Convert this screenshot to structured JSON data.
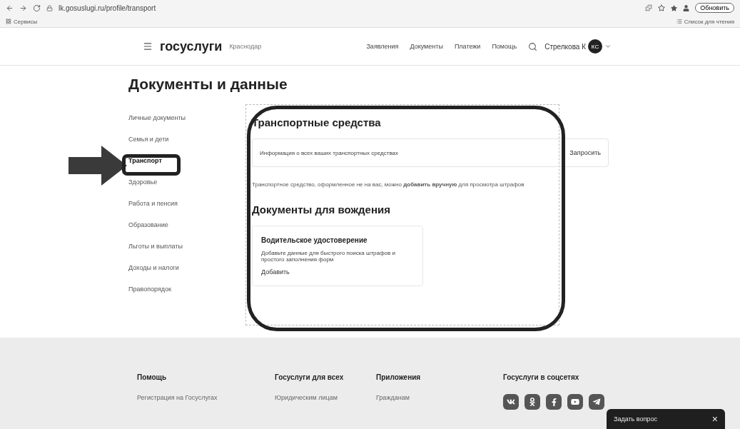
{
  "browser": {
    "url": "lk.gosuslugi.ru/profile/transport",
    "update_button": "Обновить",
    "bookmarks_left": "Сервисы",
    "bookmarks_right": "Список для чтения"
  },
  "header": {
    "logo": "госуслуги",
    "city": "Краснодар",
    "nav": [
      "Заявления",
      "Документы",
      "Платежи",
      "Помощь"
    ],
    "user": "Стрелкова К",
    "avatar": "КС"
  },
  "page_title": "Документы и данные",
  "sidebar": {
    "items": [
      {
        "label": "Личные документы",
        "selected": false
      },
      {
        "label": "Семья и дети",
        "selected": false
      },
      {
        "label": "Транспорт",
        "selected": true
      },
      {
        "label": "Здоровье",
        "selected": false
      },
      {
        "label": "Работа и пенсия",
        "selected": false
      },
      {
        "label": "Образование",
        "selected": false
      },
      {
        "label": "Льготы и выплаты",
        "selected": false
      },
      {
        "label": "Доходы и налоги",
        "selected": false
      },
      {
        "label": "Правопорядок",
        "selected": false
      }
    ]
  },
  "vehicles": {
    "title": "Транспортные средства",
    "request_row": {
      "text": "Информация о всех ваших транспортных средствах",
      "action": "Запросить"
    },
    "note": "Транспортное средство, оформленное не на вас, можно **добавить вручную** для просмотра штрафов"
  },
  "driving": {
    "title": "Документы для вождения",
    "card": {
      "title": "Водительское удостоверение",
      "text": "Добавьте данные для быстрого поиска штрафов и простого заполнения форм",
      "action": "Добавить"
    }
  },
  "footer": {
    "columns": [
      {
        "title": "Помощь",
        "link": "Регистрация на Госуслугах"
      },
      {
        "title": "Госуслуги для всех",
        "link": "Юридическим лицам"
      },
      {
        "title": "Приложения",
        "link": "Гражданам"
      }
    ],
    "social": {
      "title": "Госуслуги в соцсетях",
      "networks": [
        {
          "kind": "vk"
        },
        {
          "kind": "ok"
        },
        {
          "kind": "facebook"
        },
        {
          "kind": "youtube"
        },
        {
          "kind": "telegram"
        }
      ]
    }
  },
  "chat": {
    "label": "Задать вопрос",
    "close": "×"
  }
}
